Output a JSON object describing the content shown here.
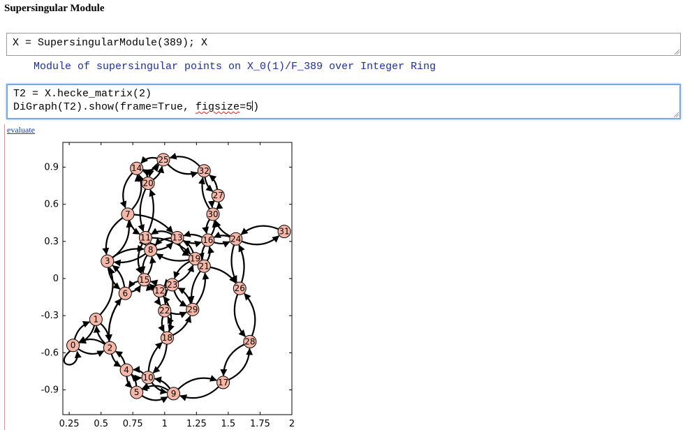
{
  "page": {
    "title": "Supersingular Module"
  },
  "cell1": {
    "input": "X = SupersingularModule(389); X"
  },
  "output1": {
    "text": "Module of supersingular points on X_0(1)/F_389 over Integer Ring"
  },
  "cell2": {
    "line1": "T2 = X.hecke_matrix(2)",
    "line2_prefix": "DiGraph(T2).show(frame=True, ",
    "line2_misspelled": "figsize",
    "line2_suffix": "=5)"
  },
  "evaluate_link": "evaluate",
  "colors": {
    "node_fill": "#f7b7a6",
    "accent_border": "#7aa7e8",
    "output_text": "#1c2ea8",
    "link": "#1a3ac8"
  },
  "chart_data": {
    "type": "digraph",
    "xlim": [
      0.2,
      2.0
    ],
    "ylim": [
      -1.1,
      1.1
    ],
    "xticks": [
      0.25,
      0.5,
      0.75,
      1,
      1.25,
      1.5,
      1.75,
      2
    ],
    "xtick_labels": [
      "0.25",
      "0.5",
      "0.75",
      "1",
      "1.25",
      "1.5",
      "1.75",
      "2"
    ],
    "yticks": [
      0.9,
      0.6,
      0.3,
      0,
      -0.3,
      -0.6,
      -0.9
    ],
    "ytick_labels": [
      "0.9",
      "0.6",
      "0.3",
      "0",
      "-0.3",
      "-0.6",
      "-0.9"
    ],
    "frame": true,
    "nodes": [
      {
        "id": "0",
        "x": 0.28,
        "y": -0.54
      },
      {
        "id": "1",
        "x": 0.46,
        "y": -0.33
      },
      {
        "id": "2",
        "x": 0.57,
        "y": -0.56
      },
      {
        "id": "3",
        "x": 0.55,
        "y": 0.14
      },
      {
        "id": "4",
        "x": 0.7,
        "y": -0.74
      },
      {
        "id": "5",
        "x": 0.78,
        "y": -0.92
      },
      {
        "id": "6",
        "x": 0.69,
        "y": -0.12
      },
      {
        "id": "7",
        "x": 0.71,
        "y": 0.52
      },
      {
        "id": "8",
        "x": 0.89,
        "y": 0.23
      },
      {
        "id": "9",
        "x": 1.07,
        "y": -0.93
      },
      {
        "id": "10",
        "x": 0.87,
        "y": -0.8
      },
      {
        "id": "11",
        "x": 0.85,
        "y": 0.33
      },
      {
        "id": "12",
        "x": 0.96,
        "y": -0.1
      },
      {
        "id": "13",
        "x": 1.1,
        "y": 0.33
      },
      {
        "id": "14",
        "x": 0.78,
        "y": 0.89
      },
      {
        "id": "15",
        "x": 0.84,
        "y": -0.01
      },
      {
        "id": "16",
        "x": 1.34,
        "y": 0.31
      },
      {
        "id": "17",
        "x": 1.46,
        "y": -0.84
      },
      {
        "id": "18",
        "x": 1.02,
        "y": -0.48
      },
      {
        "id": "19",
        "x": 1.24,
        "y": 0.16
      },
      {
        "id": "20",
        "x": 0.87,
        "y": 0.77
      },
      {
        "id": "21",
        "x": 1.31,
        "y": 0.1
      },
      {
        "id": "22",
        "x": 1.0,
        "y": -0.26
      },
      {
        "id": "23",
        "x": 1.06,
        "y": -0.05
      },
      {
        "id": "24",
        "x": 1.56,
        "y": 0.32
      },
      {
        "id": "25",
        "x": 0.99,
        "y": 0.96
      },
      {
        "id": "26",
        "x": 1.59,
        "y": -0.08
      },
      {
        "id": "27",
        "x": 1.42,
        "y": 0.67
      },
      {
        "id": "28",
        "x": 1.67,
        "y": -0.51
      },
      {
        "id": "29",
        "x": 1.22,
        "y": -0.25
      },
      {
        "id": "30",
        "x": 1.38,
        "y": 0.52
      },
      {
        "id": "31",
        "x": 1.94,
        "y": 0.38
      },
      {
        "id": "32",
        "x": 1.31,
        "y": 0.87
      }
    ],
    "edges": [
      [
        "0",
        "1",
        -0.25
      ],
      [
        "1",
        "0",
        -0.25
      ],
      [
        "0",
        "2",
        0.3
      ],
      [
        "2",
        "0",
        0.3
      ],
      [
        "0",
        "0",
        0
      ],
      [
        "1",
        "2",
        -0.2
      ],
      [
        "2",
        "1",
        -0.2
      ],
      [
        "1",
        "3",
        0.3
      ],
      [
        "3",
        "6",
        0.2
      ],
      [
        "6",
        "3",
        0.2
      ],
      [
        "2",
        "4",
        0.2
      ],
      [
        "4",
        "2",
        0.2
      ],
      [
        "2",
        "6",
        -0.2
      ],
      [
        "4",
        "5",
        0.2
      ],
      [
        "5",
        "4",
        0.2
      ],
      [
        "4",
        "10",
        0.2
      ],
      [
        "10",
        "4",
        0.2
      ],
      [
        "5",
        "9",
        0.3
      ],
      [
        "9",
        "5",
        0.3
      ],
      [
        "5",
        "10",
        0.2
      ],
      [
        "10",
        "9",
        0.2
      ],
      [
        "9",
        "10",
        0.2
      ],
      [
        "9",
        "17",
        -0.3
      ],
      [
        "17",
        "9",
        -0.3
      ],
      [
        "10",
        "18",
        -0.2
      ],
      [
        "18",
        "10",
        -0.2
      ],
      [
        "17",
        "28",
        0.3
      ],
      [
        "28",
        "17",
        0.3
      ],
      [
        "28",
        "26",
        0.3
      ],
      [
        "26",
        "28",
        0.3
      ],
      [
        "26",
        "24",
        0.2
      ],
      [
        "24",
        "26",
        0.2
      ],
      [
        "24",
        "31",
        0.3
      ],
      [
        "31",
        "24",
        0.3
      ],
      [
        "24",
        "16",
        0.2
      ],
      [
        "16",
        "24",
        0.2
      ],
      [
        "24",
        "30",
        -0.2
      ],
      [
        "30",
        "27",
        0.2
      ],
      [
        "27",
        "30",
        0.2
      ],
      [
        "27",
        "32",
        0.2
      ],
      [
        "32",
        "27",
        0.2
      ],
      [
        "32",
        "25",
        0.3
      ],
      [
        "25",
        "32",
        0.3
      ],
      [
        "30",
        "32",
        -0.2
      ],
      [
        "25",
        "14",
        0.3
      ],
      [
        "14",
        "25",
        0.3
      ],
      [
        "25",
        "20",
        0.2
      ],
      [
        "20",
        "25",
        0.2
      ],
      [
        "14",
        "20",
        0.3
      ],
      [
        "20",
        "14",
        0.3
      ],
      [
        "14",
        "7",
        0.3
      ],
      [
        "7",
        "14",
        0.3
      ],
      [
        "20",
        "11",
        0.2
      ],
      [
        "11",
        "20",
        0.2
      ],
      [
        "7",
        "3",
        0.3
      ],
      [
        "3",
        "7",
        0.3
      ],
      [
        "7",
        "11",
        0.2
      ],
      [
        "11",
        "8",
        0.2
      ],
      [
        "8",
        "11",
        0.2
      ],
      [
        "7",
        "13",
        -0.2
      ],
      [
        "13",
        "8",
        0.2
      ],
      [
        "8",
        "13",
        0.2
      ],
      [
        "3",
        "8",
        -0.2
      ],
      [
        "8",
        "3",
        -0.2
      ],
      [
        "8",
        "15",
        0.2
      ],
      [
        "15",
        "8",
        0.2
      ],
      [
        "11",
        "15",
        0.25
      ],
      [
        "15",
        "12",
        0.2
      ],
      [
        "12",
        "15",
        0.2
      ],
      [
        "15",
        "6",
        0.2
      ],
      [
        "6",
        "15",
        0.2
      ],
      [
        "12",
        "23",
        0.2
      ],
      [
        "23",
        "12",
        0.2
      ],
      [
        "12",
        "22",
        0.2
      ],
      [
        "22",
        "12",
        0.2
      ],
      [
        "23",
        "19",
        0.2
      ],
      [
        "19",
        "23",
        0.2
      ],
      [
        "23",
        "29",
        0.2
      ],
      [
        "29",
        "23",
        0.2
      ],
      [
        "22",
        "18",
        0.2
      ],
      [
        "18",
        "22",
        0.2
      ],
      [
        "29",
        "21",
        0.2
      ],
      [
        "21",
        "29",
        0.2
      ],
      [
        "18",
        "29",
        0.2
      ],
      [
        "19",
        "21",
        0.2
      ],
      [
        "21",
        "19",
        0.2
      ],
      [
        "19",
        "13",
        0.2
      ],
      [
        "13",
        "19",
        0.2
      ],
      [
        "13",
        "16",
        0.2
      ],
      [
        "16",
        "13",
        0.2
      ],
      [
        "16",
        "21",
        0.2
      ],
      [
        "21",
        "16",
        0.2
      ],
      [
        "21",
        "26",
        -0.2
      ],
      [
        "16",
        "30",
        0.2
      ],
      [
        "30",
        "16",
        0.2
      ],
      [
        "13",
        "11",
        0.3
      ],
      [
        "19",
        "8",
        -0.2
      ],
      [
        "23",
        "15",
        -0.3
      ],
      [
        "22",
        "29",
        0.2
      ],
      [
        "6",
        "2",
        0.2
      ],
      [
        "12",
        "18",
        -0.25
      ],
      [
        "11",
        "19",
        -0.2
      ]
    ]
  }
}
